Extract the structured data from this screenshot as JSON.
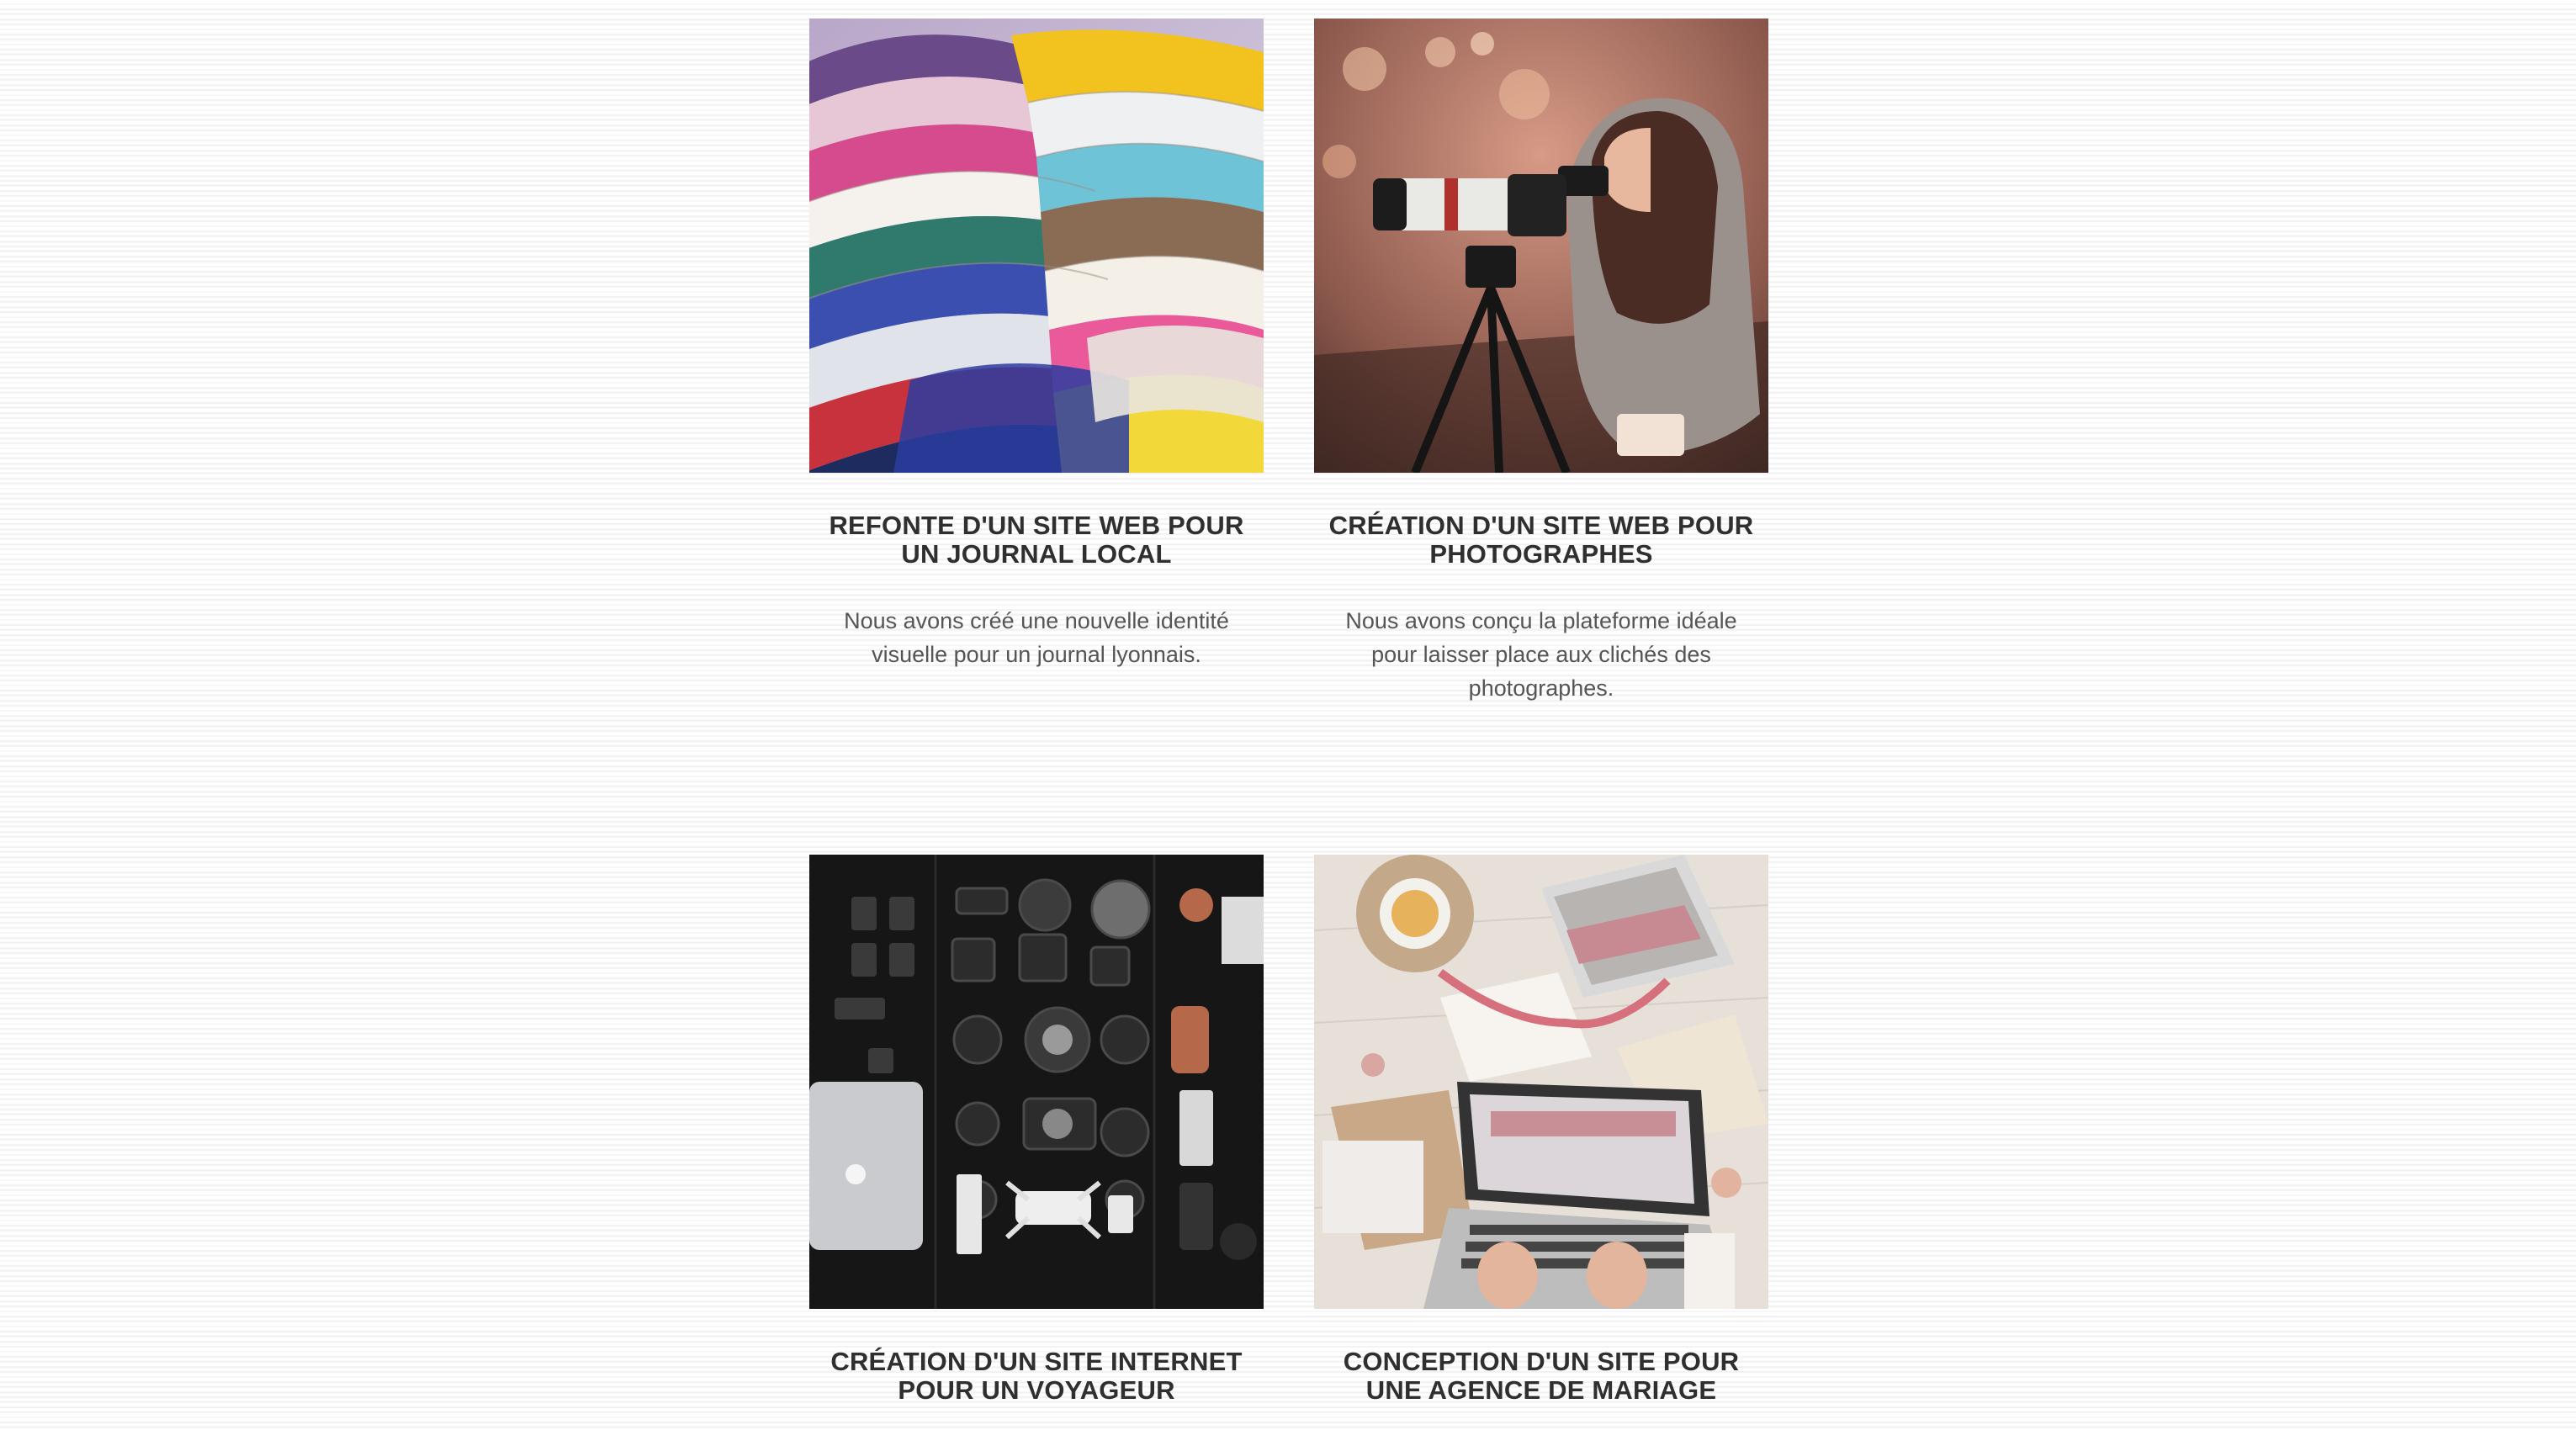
{
  "portfolio": {
    "items": [
      {
        "title": "REFONTE D'UN SITE WEB POUR UN JOURNAL LOCAL",
        "description": "Nous avons créé une nouvelle identité visuelle pour un journal lyonnais.",
        "image": "stacked-magazines-photo"
      },
      {
        "title": "CRÉATION D'UN SITE WEB POUR PHOTOGRAPHES",
        "description": "Nous avons conçu la plateforme idéale pour laisser place aux clichés des photographes.",
        "image": "photographer-with-camera-photo"
      },
      {
        "title": "CRÉATION D'UN SITE INTERNET POUR UN VOYAGEUR",
        "description": "",
        "image": "camera-gear-flatlay-photo"
      },
      {
        "title": "CONCEPTION D'UN SITE POUR UNE AGENCE DE MARIAGE",
        "description": "",
        "image": "laptop-desk-wedding-photo"
      }
    ]
  }
}
